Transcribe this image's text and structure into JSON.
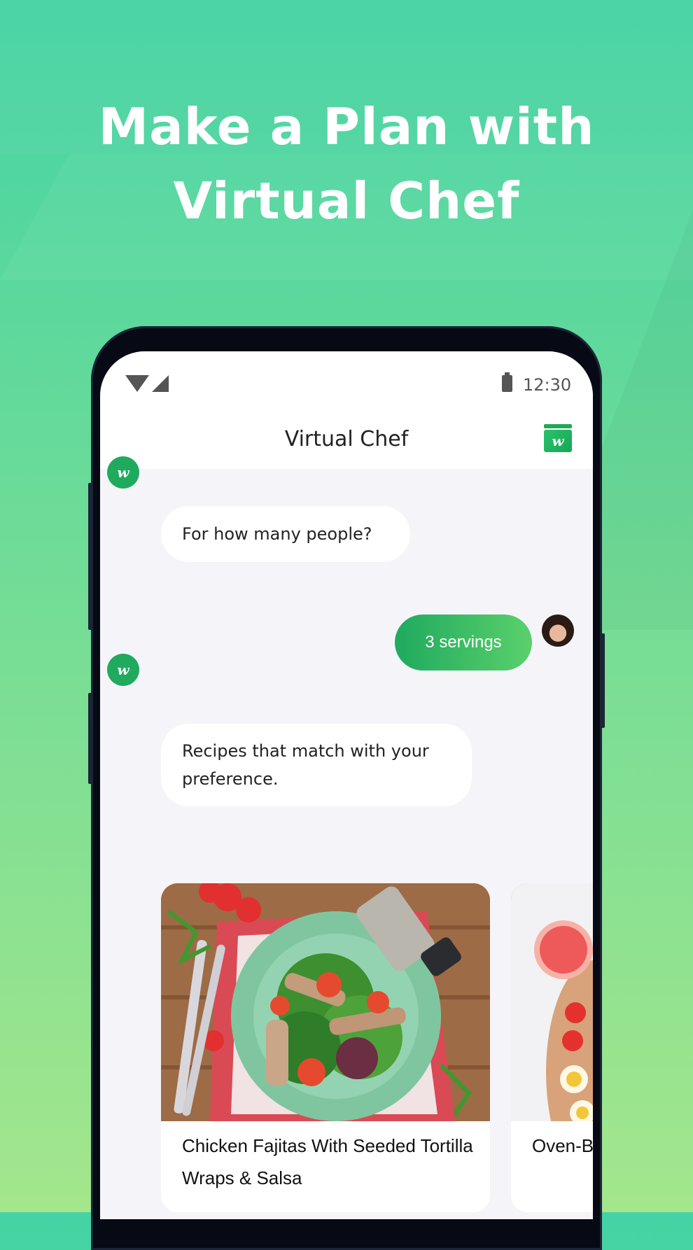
{
  "headline": {
    "line1": "Make a Plan with",
    "line2": "Virtual Chef"
  },
  "status_bar": {
    "time": "12:30",
    "icons": [
      "wifi-icon",
      "signal-icon",
      "battery-icon"
    ]
  },
  "app_bar": {
    "title": "Virtual Chef",
    "logo_icon": "w-jar-logo-icon",
    "logo_letter": "w"
  },
  "chat": {
    "bot_avatar_letter": "w",
    "messages": [
      {
        "from": "bot",
        "text": "For how many people?"
      },
      {
        "from": "user",
        "text": "3 servings"
      },
      {
        "from": "bot",
        "text": "Recipes that match with your preference."
      }
    ]
  },
  "recipes": [
    {
      "title": "Chicken Fajitas With Seeded Tortilla Wraps & Salsa",
      "image_icon": "chicken-salad-photo"
    },
    {
      "title": "Oven-B",
      "image_icon": "grapefruit-egg-board-photo"
    }
  ],
  "colors": {
    "accent_green": "#1faa5e",
    "bg_top": "#44d3a4",
    "bg_bottom": "#a4e68c",
    "bubble_bg": "#ffffff",
    "chat_bg": "#f5f5f9"
  }
}
